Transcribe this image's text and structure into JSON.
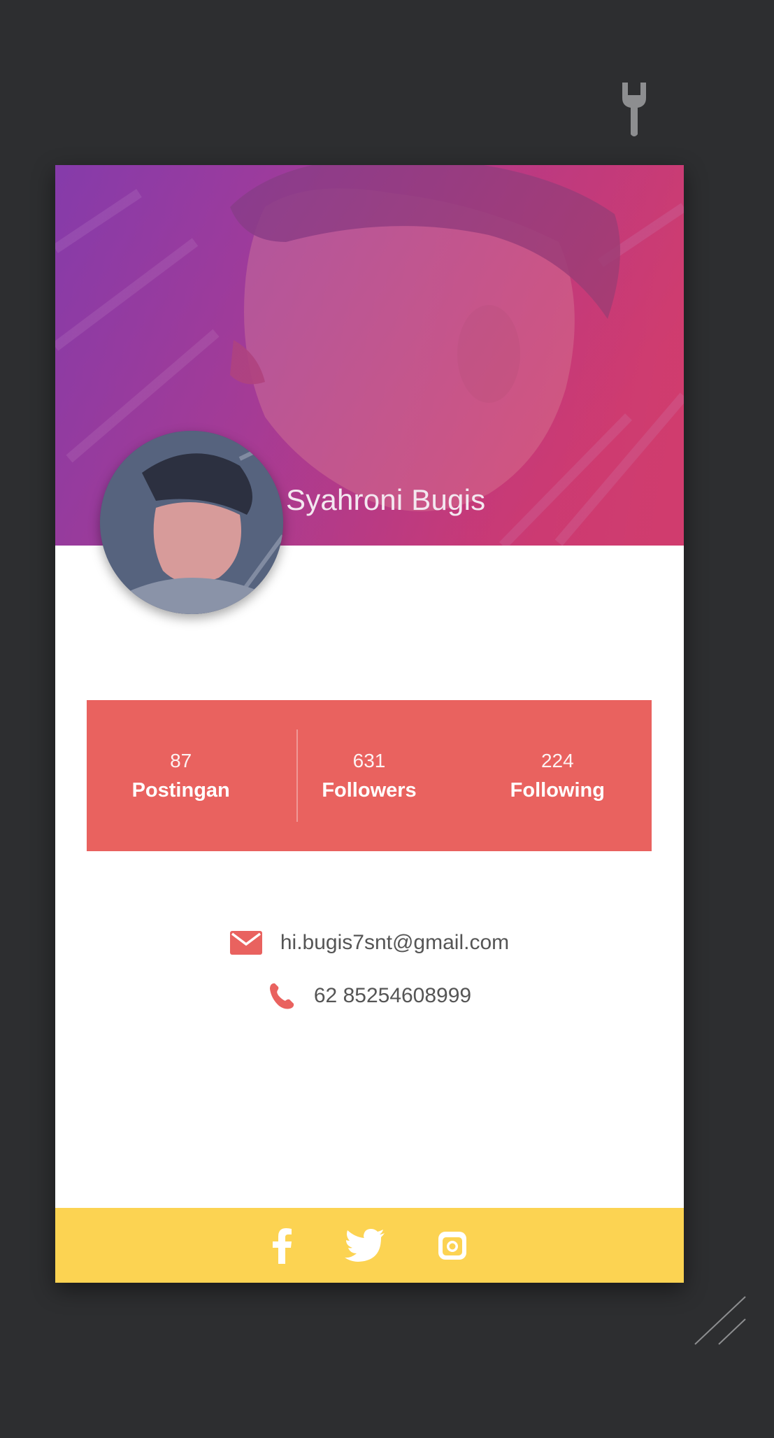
{
  "profile": {
    "name": "Syahroni Bugis"
  },
  "stats": [
    {
      "value": "87",
      "label": "Postingan"
    },
    {
      "value": "631",
      "label": "Followers"
    },
    {
      "value": "224",
      "label": "Following"
    }
  ],
  "contact": {
    "email": "hi.bugis7snt@gmail.com",
    "phone": "62 85254608999"
  },
  "icons": {
    "settings": "wrench-icon",
    "email": "mail-icon",
    "phone": "phone-icon",
    "facebook": "facebook-icon",
    "twitter": "twitter-icon",
    "instagram": "instagram-icon",
    "resize": "resize-handle-icon"
  },
  "colors": {
    "background": "#2d2e30",
    "stats_bar": "#e9625f",
    "footer": "#fcd352",
    "accent": "#e9625f"
  }
}
